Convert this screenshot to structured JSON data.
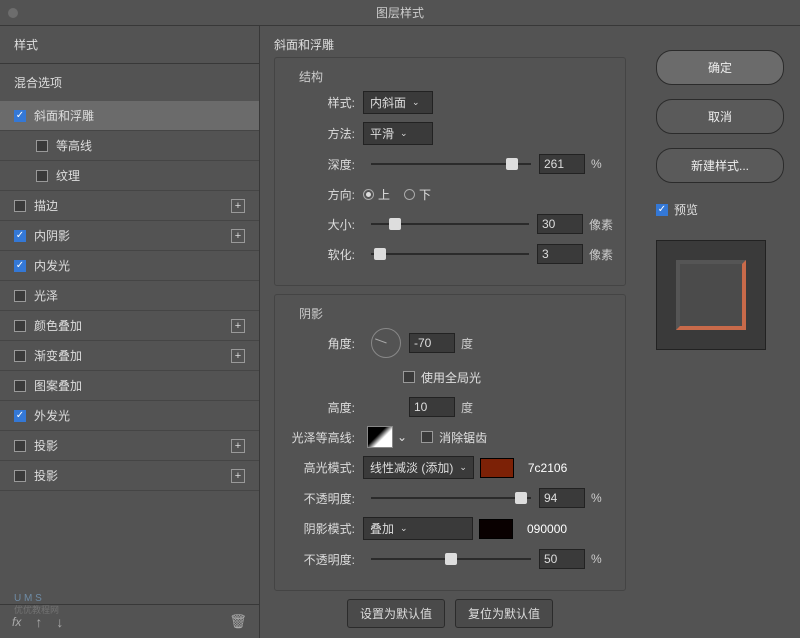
{
  "title": "图层样式",
  "sidebar": {
    "header": "样式",
    "blend": "混合选项",
    "items": [
      {
        "label": "斜面和浮雕",
        "checked": true,
        "selected": true,
        "plus": false
      },
      {
        "label": "等高线",
        "checked": false,
        "child": true
      },
      {
        "label": "纹理",
        "checked": false,
        "child": true
      },
      {
        "label": "描边",
        "checked": false,
        "plus": true
      },
      {
        "label": "内阴影",
        "checked": true,
        "plus": true
      },
      {
        "label": "内发光",
        "checked": true,
        "plus": false
      },
      {
        "label": "光泽",
        "checked": false,
        "plus": false
      },
      {
        "label": "颜色叠加",
        "checked": false,
        "plus": true
      },
      {
        "label": "渐变叠加",
        "checked": false,
        "plus": true
      },
      {
        "label": "图案叠加",
        "checked": false,
        "plus": false
      },
      {
        "label": "外发光",
        "checked": true,
        "plus": false
      },
      {
        "label": "投影",
        "checked": false,
        "plus": true
      },
      {
        "label": "投影",
        "checked": false,
        "plus": true
      }
    ],
    "fx": "fx"
  },
  "panel": {
    "title": "斜面和浮雕",
    "structure": {
      "title": "结构",
      "styleLabel": "样式:",
      "styleValue": "内斜面",
      "methodLabel": "方法:",
      "methodValue": "平滑",
      "depthLabel": "深度:",
      "depthValue": "261",
      "depthUnit": "%",
      "dirLabel": "方向:",
      "up": "上",
      "down": "下",
      "sizeLabel": "大小:",
      "sizeValue": "30",
      "sizeUnit": "像素",
      "softLabel": "软化:",
      "softValue": "3",
      "softUnit": "像素"
    },
    "shadow": {
      "title": "阴影",
      "angleLabel": "角度:",
      "angleValue": "-70",
      "angleUnit": "度",
      "globalLight": "使用全局光",
      "heightLabel": "高度:",
      "heightValue": "10",
      "heightUnit": "度",
      "contourLabel": "光泽等高线:",
      "antialias": "消除锯齿",
      "hlModeLabel": "高光模式:",
      "hlModeValue": "线性减淡 (添加)",
      "hlColor": "#7c2106",
      "hlHex": "7c2106",
      "hlOpacityLabel": "不透明度:",
      "hlOpacityValue": "94",
      "pct": "%",
      "shModeLabel": "阴影模式:",
      "shModeValue": "叠加",
      "shColor": "#090000",
      "shHex": "090000",
      "shOpacityLabel": "不透明度:",
      "shOpacityValue": "50"
    },
    "buttons": {
      "default": "设置为默认值",
      "reset": "复位为默认值"
    }
  },
  "right": {
    "ok": "确定",
    "cancel": "取消",
    "newStyle": "新建样式...",
    "preview": "预览"
  }
}
